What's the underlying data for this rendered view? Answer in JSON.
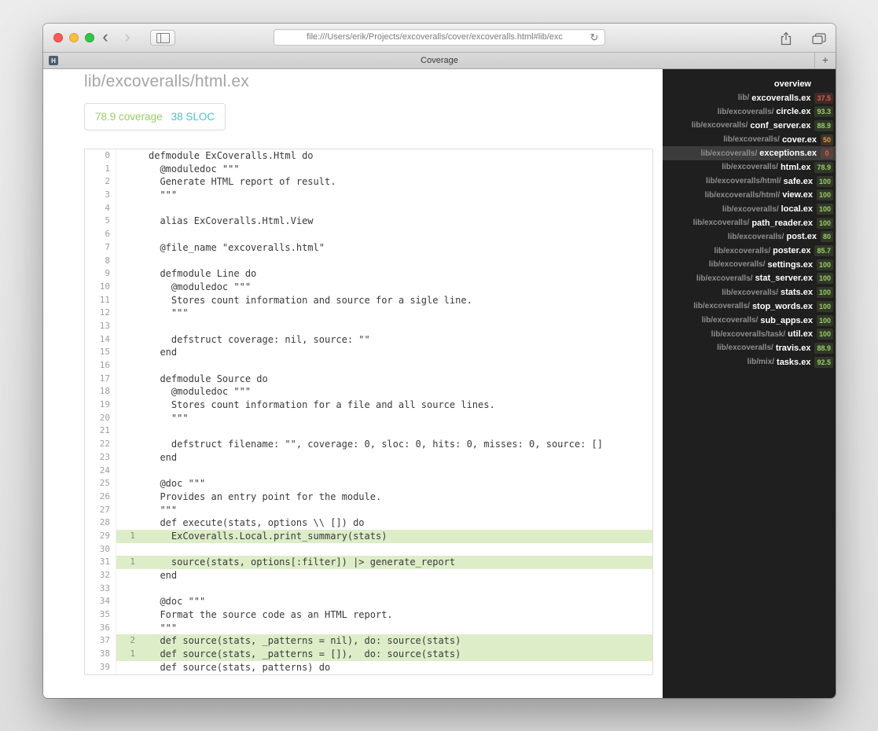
{
  "colors": {
    "accent_green": "#99cc66",
    "accent_teal": "#4bc0c8",
    "accent_orange": "#d99a4e",
    "accent_red": "#d6604f",
    "covered_bg": "#dcedc8"
  },
  "browser": {
    "url": "file:///Users/erik/Projects/excoveralls/cover/excoveralls.html#lib/exc",
    "tab_title": "Coverage",
    "favicon_text": "H",
    "icons": {
      "back": "‹",
      "forward": "›",
      "reload": "↻",
      "new_tab": "+"
    }
  },
  "page": {
    "title": "lib/excoveralls/html.ex",
    "coverage": "78.9",
    "coverage_label": "coverage",
    "sloc": "38",
    "sloc_label": "SLOC"
  },
  "code": {
    "lines": [
      {
        "num": "0",
        "hits": "",
        "cov": false,
        "text": "defmodule ExCoveralls.Html do"
      },
      {
        "num": "1",
        "hits": "",
        "cov": false,
        "text": "  @moduledoc \"\"\""
      },
      {
        "num": "2",
        "hits": "",
        "cov": false,
        "text": "  Generate HTML report of result."
      },
      {
        "num": "3",
        "hits": "",
        "cov": false,
        "text": "  \"\"\""
      },
      {
        "num": "4",
        "hits": "",
        "cov": false,
        "text": ""
      },
      {
        "num": "5",
        "hits": "",
        "cov": false,
        "text": "  alias ExCoveralls.Html.View"
      },
      {
        "num": "6",
        "hits": "",
        "cov": false,
        "text": ""
      },
      {
        "num": "7",
        "hits": "",
        "cov": false,
        "text": "  @file_name \"excoveralls.html\""
      },
      {
        "num": "8",
        "hits": "",
        "cov": false,
        "text": ""
      },
      {
        "num": "9",
        "hits": "",
        "cov": false,
        "text": "  defmodule Line do"
      },
      {
        "num": "10",
        "hits": "",
        "cov": false,
        "text": "    @moduledoc \"\"\""
      },
      {
        "num": "11",
        "hits": "",
        "cov": false,
        "text": "    Stores count information and source for a sigle line."
      },
      {
        "num": "12",
        "hits": "",
        "cov": false,
        "text": "    \"\"\""
      },
      {
        "num": "13",
        "hits": "",
        "cov": false,
        "text": ""
      },
      {
        "num": "14",
        "hits": "",
        "cov": false,
        "text": "    defstruct coverage: nil, source: \"\""
      },
      {
        "num": "15",
        "hits": "",
        "cov": false,
        "text": "  end"
      },
      {
        "num": "16",
        "hits": "",
        "cov": false,
        "text": ""
      },
      {
        "num": "17",
        "hits": "",
        "cov": false,
        "text": "  defmodule Source do"
      },
      {
        "num": "18",
        "hits": "",
        "cov": false,
        "text": "    @moduledoc \"\"\""
      },
      {
        "num": "19",
        "hits": "",
        "cov": false,
        "text": "    Stores count information for a file and all source lines."
      },
      {
        "num": "20",
        "hits": "",
        "cov": false,
        "text": "    \"\"\""
      },
      {
        "num": "21",
        "hits": "",
        "cov": false,
        "text": ""
      },
      {
        "num": "22",
        "hits": "",
        "cov": false,
        "text": "    defstruct filename: \"\", coverage: 0, sloc: 0, hits: 0, misses: 0, source: []"
      },
      {
        "num": "23",
        "hits": "",
        "cov": false,
        "text": "  end"
      },
      {
        "num": "24",
        "hits": "",
        "cov": false,
        "text": ""
      },
      {
        "num": "25",
        "hits": "",
        "cov": false,
        "text": "  @doc \"\"\""
      },
      {
        "num": "26",
        "hits": "",
        "cov": false,
        "text": "  Provides an entry point for the module."
      },
      {
        "num": "27",
        "hits": "",
        "cov": false,
        "text": "  \"\"\""
      },
      {
        "num": "28",
        "hits": "",
        "cov": false,
        "text": "  def execute(stats, options \\\\ []) do"
      },
      {
        "num": "29",
        "hits": "1",
        "cov": true,
        "text": "    ExCoveralls.Local.print_summary(stats)"
      },
      {
        "num": "30",
        "hits": "",
        "cov": false,
        "text": ""
      },
      {
        "num": "31",
        "hits": "1",
        "cov": true,
        "text": "    source(stats, options[:filter]) |> generate_report"
      },
      {
        "num": "32",
        "hits": "",
        "cov": false,
        "text": "  end"
      },
      {
        "num": "33",
        "hits": "",
        "cov": false,
        "text": ""
      },
      {
        "num": "34",
        "hits": "",
        "cov": false,
        "text": "  @doc \"\"\""
      },
      {
        "num": "35",
        "hits": "",
        "cov": false,
        "text": "  Format the source code as an HTML report."
      },
      {
        "num": "36",
        "hits": "",
        "cov": false,
        "text": "  \"\"\""
      },
      {
        "num": "37",
        "hits": "2",
        "cov": true,
        "text": "  def source(stats, _patterns = nil), do: source(stats)"
      },
      {
        "num": "38",
        "hits": "1",
        "cov": true,
        "text": "  def source(stats, _patterns = []),  do: source(stats)"
      },
      {
        "num": "39",
        "hits": "",
        "cov": false,
        "text": "  def source(stats, patterns) do"
      }
    ]
  },
  "sidebar": {
    "overview_label": "overview",
    "files": [
      {
        "dir": "lib/",
        "name": "excoveralls.ex",
        "pct": "37.5",
        "status": "low",
        "selected": false
      },
      {
        "dir": "lib/excoveralls/",
        "name": "circle.ex",
        "pct": "93.3",
        "status": "high",
        "selected": false
      },
      {
        "dir": "lib/excoveralls/",
        "name": "conf_server.ex",
        "pct": "88.9",
        "status": "high",
        "selected": false
      },
      {
        "dir": "lib/excoveralls/",
        "name": "cover.ex",
        "pct": "50",
        "status": "mid",
        "selected": false
      },
      {
        "dir": "lib/excoveralls/",
        "name": "exceptions.ex",
        "pct": "0",
        "status": "low",
        "selected": true
      },
      {
        "dir": "lib/excoveralls/",
        "name": "html.ex",
        "pct": "78.9",
        "status": "high",
        "selected": false
      },
      {
        "dir": "lib/excoveralls/html/",
        "name": "safe.ex",
        "pct": "100",
        "status": "high",
        "selected": false
      },
      {
        "dir": "lib/excoveralls/html/",
        "name": "view.ex",
        "pct": "100",
        "status": "high",
        "selected": false
      },
      {
        "dir": "lib/excoveralls/",
        "name": "local.ex",
        "pct": "100",
        "status": "high",
        "selected": false
      },
      {
        "dir": "lib/excoveralls/",
        "name": "path_reader.ex",
        "pct": "100",
        "status": "high",
        "selected": false
      },
      {
        "dir": "lib/excoveralls/",
        "name": "post.ex",
        "pct": "80",
        "status": "high",
        "selected": false
      },
      {
        "dir": "lib/excoveralls/",
        "name": "poster.ex",
        "pct": "85.7",
        "status": "high",
        "selected": false
      },
      {
        "dir": "lib/excoveralls/",
        "name": "settings.ex",
        "pct": "100",
        "status": "high",
        "selected": false
      },
      {
        "dir": "lib/excoveralls/",
        "name": "stat_server.ex",
        "pct": "100",
        "status": "high",
        "selected": false
      },
      {
        "dir": "lib/excoveralls/",
        "name": "stats.ex",
        "pct": "100",
        "status": "high",
        "selected": false
      },
      {
        "dir": "lib/excoveralls/",
        "name": "stop_words.ex",
        "pct": "100",
        "status": "high",
        "selected": false
      },
      {
        "dir": "lib/excoveralls/",
        "name": "sub_apps.ex",
        "pct": "100",
        "status": "high",
        "selected": false
      },
      {
        "dir": "lib/excoveralls/task/",
        "name": "util.ex",
        "pct": "100",
        "status": "high",
        "selected": false
      },
      {
        "dir": "lib/excoveralls/",
        "name": "travis.ex",
        "pct": "88.9",
        "status": "high",
        "selected": false
      },
      {
        "dir": "lib/mix/",
        "name": "tasks.ex",
        "pct": "92.5",
        "status": "high",
        "selected": false
      }
    ]
  }
}
